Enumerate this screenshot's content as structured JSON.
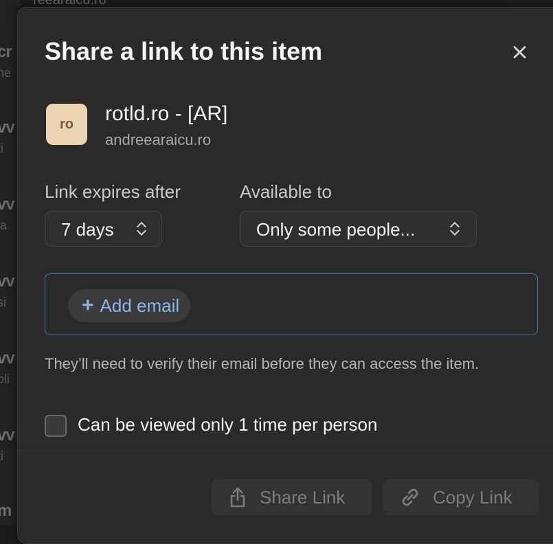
{
  "background": {
    "url_partial": "reearaicu.ro",
    "rows": [
      {
        "title": "cr",
        "sub": "ne"
      },
      {
        "title": "vv",
        "sub": "ti"
      },
      {
        "title": "vv",
        "sub": "ia"
      },
      {
        "title": "vv",
        "sub": "si"
      },
      {
        "title": "vv",
        "sub": "oli"
      },
      {
        "title": "vv",
        "sub": "ti"
      },
      {
        "title": "m",
        "sub": ""
      }
    ]
  },
  "dialog": {
    "title": "Share a link to this item",
    "item": {
      "avatar_text": "ro",
      "name": "rotld.ro - [AR]",
      "subtitle": "andreearaicu.ro"
    },
    "expires": {
      "label": "Link expires after",
      "value": "7 days"
    },
    "available": {
      "label": "Available to",
      "value": "Only some people..."
    },
    "add_email_label": "Add email",
    "note": "They’ll need to verify their email before they can access the item.",
    "view_once": {
      "label": "Can be viewed only 1 time per person",
      "checked": false
    },
    "buttons": {
      "share_label": "Share Link",
      "copy_label": "Copy Link"
    }
  },
  "colors": {
    "accent": "#8ab4f0",
    "email_border": "#5174a6",
    "avatar_bg": "#ecd3b1"
  }
}
